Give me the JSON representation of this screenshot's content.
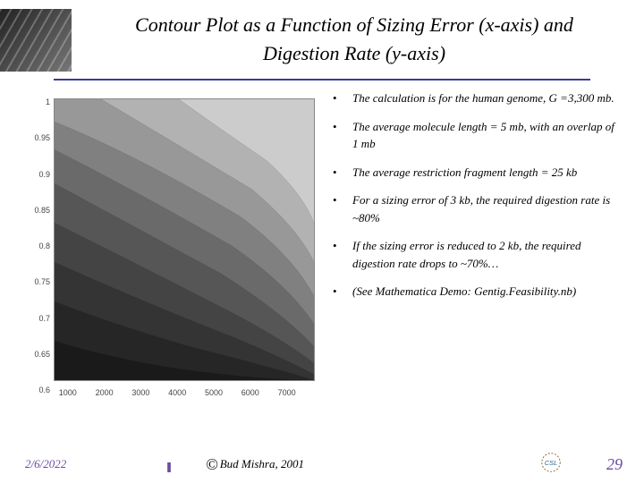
{
  "title": {
    "line1": "Contour Plot as a Function of Sizing Error (x-axis) and",
    "line2": "Digestion Rate (y-axis)"
  },
  "bullets": [
    "The calculation is for the human genome, G =3,300 mb.",
    "The average molecule length = 5 mb, with an overlap of 1 mb",
    "The average restriction fragment length = 25 kb",
    "For a sizing error of 3 kb, the required digestion rate is ~80%",
    "If the sizing error is reduced to 2 kb, the required digestion rate drops to ~70%…",
    "(See Mathematica Demo: Gentig.Feasibility.nb)"
  ],
  "footer": {
    "date": "2/6/2022",
    "credit": "Bud Mishra, 2001",
    "pagenum": "29"
  },
  "chart_data": {
    "type": "heatmap",
    "title": "",
    "xlabel": "",
    "ylabel": "",
    "x_ticks": [
      1000,
      2000,
      3000,
      4000,
      5000,
      6000,
      7000
    ],
    "y_ticks": [
      0.6,
      0.65,
      0.7,
      0.75,
      0.8,
      0.85,
      0.9,
      0.95,
      1
    ],
    "xlim": [
      500,
      7500
    ],
    "ylim": [
      0.55,
      1.0
    ],
    "note": "Greyscale contour bands; lighter = higher value toward upper-left (low sizing error, high digestion rate); darker toward lower-right.",
    "contour_levels_approx": 10
  },
  "colors": {
    "rule": "#3b3b99",
    "accent": "#6b4ba3"
  }
}
